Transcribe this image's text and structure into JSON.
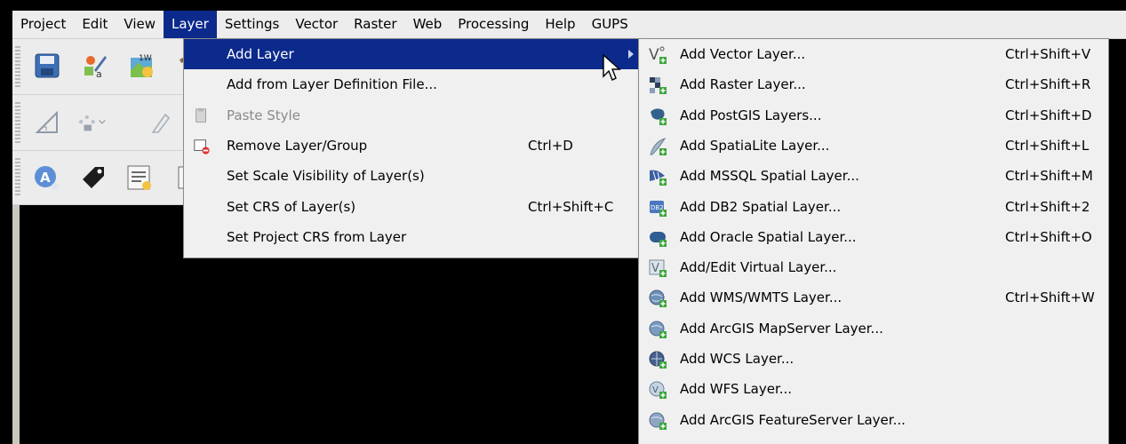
{
  "menubar": {
    "items": [
      "Project",
      "Edit",
      "View",
      "Layer",
      "Settings",
      "Vector",
      "Raster",
      "Web",
      "Processing",
      "Help",
      "GUPS"
    ],
    "active": "Layer"
  },
  "layer_menu": {
    "items": [
      {
        "label": "Add Layer",
        "shortcut": "",
        "icon": "",
        "state": "selected"
      },
      {
        "label": "Add from Layer Definition File...",
        "shortcut": "",
        "icon": "",
        "state": "normal"
      },
      {
        "label": "Paste Style",
        "shortcut": "",
        "icon": "clipboard-icon",
        "state": "disabled"
      },
      {
        "label": "Remove Layer/Group",
        "shortcut": "Ctrl+D",
        "icon": "remove-layer-icon",
        "state": "normal"
      },
      {
        "label": "Set Scale Visibility of Layer(s)",
        "shortcut": "",
        "icon": "",
        "state": "normal"
      },
      {
        "label": "Set CRS of Layer(s)",
        "shortcut": "Ctrl+Shift+C",
        "icon": "",
        "state": "normal"
      },
      {
        "label": "Set Project CRS from Layer",
        "shortcut": "",
        "icon": "",
        "state": "normal"
      }
    ]
  },
  "add_layer_submenu": {
    "items": [
      {
        "label": "Add Vector Layer...",
        "shortcut": "Ctrl+Shift+V",
        "icon": "vector-layer-icon"
      },
      {
        "label": "Add Raster Layer...",
        "shortcut": "Ctrl+Shift+R",
        "icon": "raster-layer-icon"
      },
      {
        "label": "Add PostGIS Layers...",
        "shortcut": "Ctrl+Shift+D",
        "icon": "postgis-icon"
      },
      {
        "label": "Add SpatiaLite Layer...",
        "shortcut": "Ctrl+Shift+L",
        "icon": "spatialite-icon"
      },
      {
        "label": "Add MSSQL Spatial Layer...",
        "shortcut": "Ctrl+Shift+M",
        "icon": "mssql-icon"
      },
      {
        "label": "Add DB2 Spatial Layer...",
        "shortcut": "Ctrl+Shift+2",
        "icon": "db2-icon"
      },
      {
        "label": "Add Oracle Spatial Layer...",
        "shortcut": "Ctrl+Shift+O",
        "icon": "oracle-icon"
      },
      {
        "label": "Add/Edit Virtual Layer...",
        "shortcut": "",
        "icon": "virtual-layer-icon"
      },
      {
        "label": "Add WMS/WMTS Layer...",
        "shortcut": "Ctrl+Shift+W",
        "icon": "wms-globe-icon"
      },
      {
        "label": "Add ArcGIS MapServer Layer...",
        "shortcut": "",
        "icon": "arcgis-mapserver-icon"
      },
      {
        "label": "Add WCS Layer...",
        "shortcut": "",
        "icon": "wcs-globe-icon"
      },
      {
        "label": "Add WFS Layer...",
        "shortcut": "",
        "icon": "wfs-globe-icon"
      },
      {
        "label": "Add ArcGIS FeatureServer Layer...",
        "shortcut": "",
        "icon": "arcgis-featureserver-icon"
      }
    ]
  },
  "toolbar_icons": [
    "save-project-icon",
    "style-manager-icon",
    "new-map-icon",
    "measure-icon",
    "digitize-node-icon",
    "pan-icon",
    "label-icon",
    "tag-icon",
    "attribute-table-icon"
  ],
  "colors": {
    "menu_highlight": "#0c2a8c",
    "menu_bg": "#f0f0f0"
  }
}
